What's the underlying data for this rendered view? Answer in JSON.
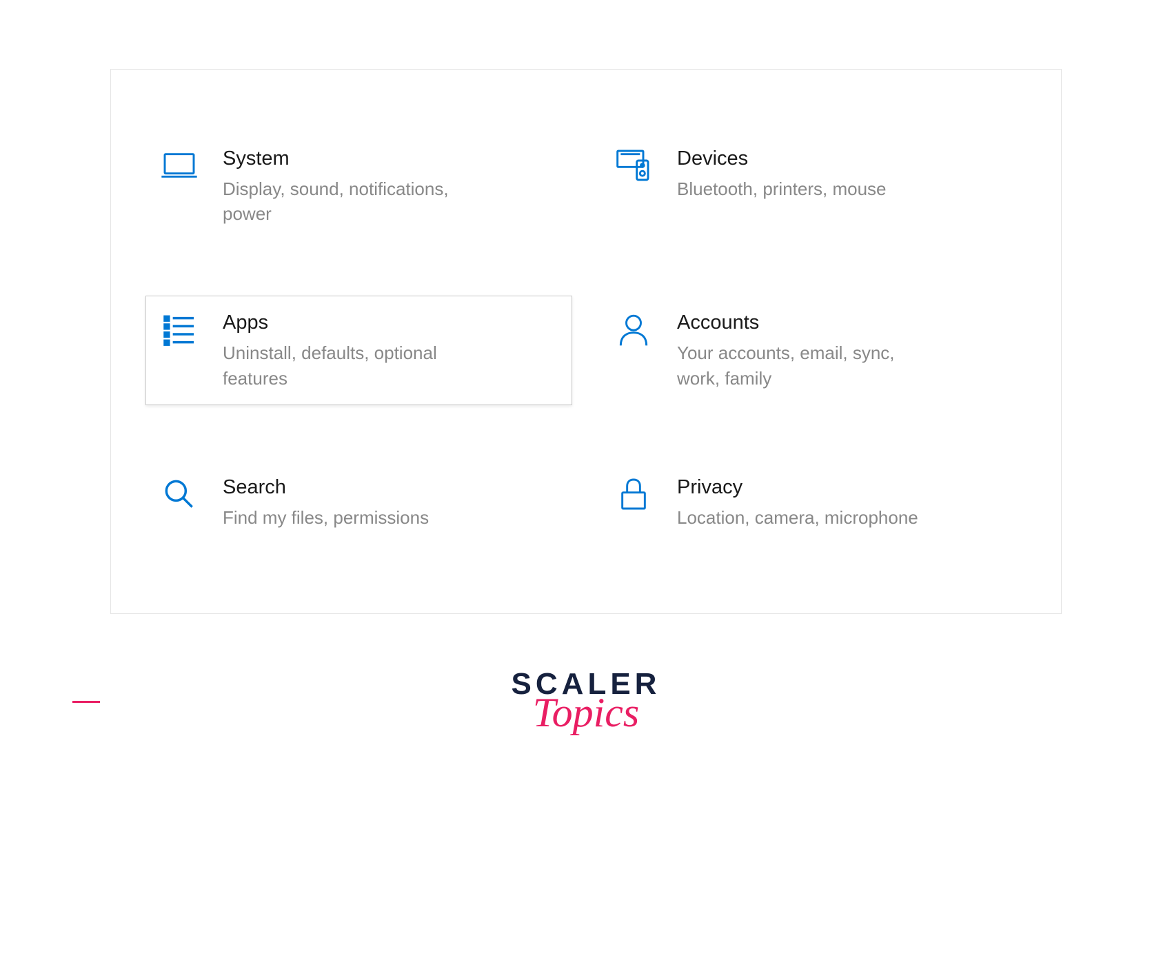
{
  "settings": {
    "items": [
      {
        "icon": "laptop-icon",
        "title": "System",
        "subtitle": "Display, sound, notifications, power",
        "highlighted": false
      },
      {
        "icon": "devices-icon",
        "title": "Devices",
        "subtitle": "Bluetooth, printers, mouse",
        "highlighted": false
      },
      {
        "icon": "apps-icon",
        "title": "Apps",
        "subtitle": "Uninstall, defaults, optional features",
        "highlighted": true
      },
      {
        "icon": "accounts-icon",
        "title": "Accounts",
        "subtitle": "Your accounts, email, sync, work, family",
        "highlighted": false
      },
      {
        "icon": "search-icon",
        "title": "Search",
        "subtitle": "Find my files, permissions",
        "highlighted": false
      },
      {
        "icon": "privacy-icon",
        "title": "Privacy",
        "subtitle": "Location, camera, microphone",
        "highlighted": false
      }
    ]
  },
  "footer": {
    "logo_top": "SCALER",
    "logo_bottom": "Topics"
  },
  "colors": {
    "accent": "#0078d4",
    "text_primary": "#1a1a1a",
    "text_secondary": "#888888",
    "border": "#e5e5e5",
    "logo_dark": "#16213e",
    "logo_pink": "#e91e63"
  }
}
